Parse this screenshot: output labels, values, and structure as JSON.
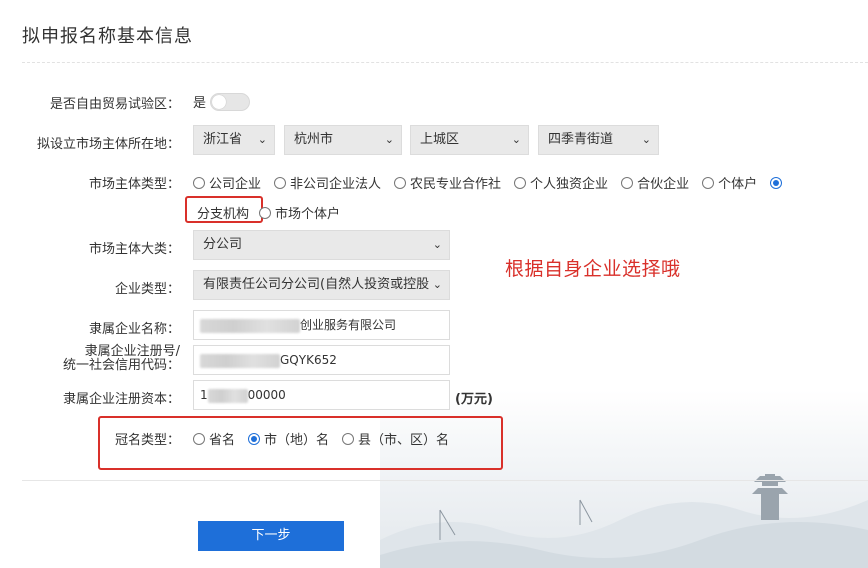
{
  "title": "拟申报名称基本信息",
  "free_trade": {
    "label": "是否自由贸易试验区：",
    "value": "是"
  },
  "location": {
    "label": "拟设立市场主体所在地：",
    "province": "浙江省",
    "city": "杭州市",
    "district": "上城区",
    "street": "四季青街道"
  },
  "entity_type": {
    "label": "市场主体类型：",
    "options": [
      "公司企业",
      "非公司企业法人",
      "农民专业合作社",
      "个人独资企业",
      "合伙企业",
      "个体户",
      "分支机构",
      "市场个体户"
    ],
    "selected": "分支机构"
  },
  "entity_category": {
    "label": "市场主体大类：",
    "value": "分公司"
  },
  "enterprise_type": {
    "label": "企业类型：",
    "value": "有限责任公司分公司(自然人投资或控股"
  },
  "parent_name": {
    "label": "隶属企业名称：",
    "value_visible": "创业服务有限公司"
  },
  "parent_reg": {
    "label_line1": "隶属企业注册号/",
    "label_line2": "统一社会信用代码：",
    "value_visible": "GQYK652"
  },
  "parent_capital": {
    "label": "隶属企业注册资本：",
    "value_prefix": "1",
    "value_suffix": "00000",
    "unit": "(万元)"
  },
  "crown_type": {
    "label": "冠名类型：",
    "options": [
      "省名",
      "市（地）名",
      "县（市、区）名"
    ],
    "selected": "市（地）名"
  },
  "annotation": "根据自身企业选择哦",
  "next_button": "下一步",
  "colors": {
    "accent": "#1e6fd9",
    "highlight": "#d9302a"
  }
}
